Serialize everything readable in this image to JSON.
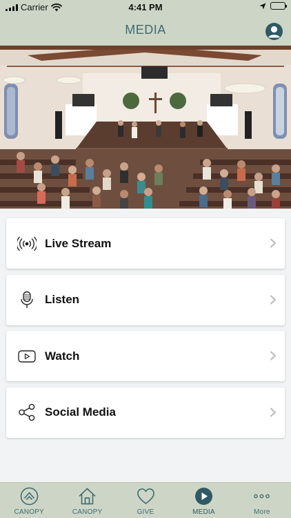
{
  "status_bar": {
    "carrier": "Carrier",
    "time": "4:41 PM"
  },
  "nav": {
    "title": "MEDIA"
  },
  "menu": {
    "items": [
      {
        "label": "Live Stream",
        "icon": "broadcast-icon"
      },
      {
        "label": "Listen",
        "icon": "microphone-icon"
      },
      {
        "label": "Watch",
        "icon": "video-play-icon"
      },
      {
        "label": "Social Media",
        "icon": "share-icon"
      }
    ]
  },
  "tabs": [
    {
      "label": "CANOPY",
      "icon": "canopy-logo-icon"
    },
    {
      "label": "CANOPY",
      "icon": "home-icon"
    },
    {
      "label": "GIVE",
      "icon": "heart-icon"
    },
    {
      "label": "MEDIA",
      "icon": "play-circle-icon",
      "active": true
    },
    {
      "label": "More",
      "icon": "more-dots-icon"
    }
  ],
  "colors": {
    "header_bg": "#cdd6c6",
    "accent": "#3f6b72",
    "accent_dark": "#2f5a63",
    "page_bg": "#f2f3f4"
  }
}
